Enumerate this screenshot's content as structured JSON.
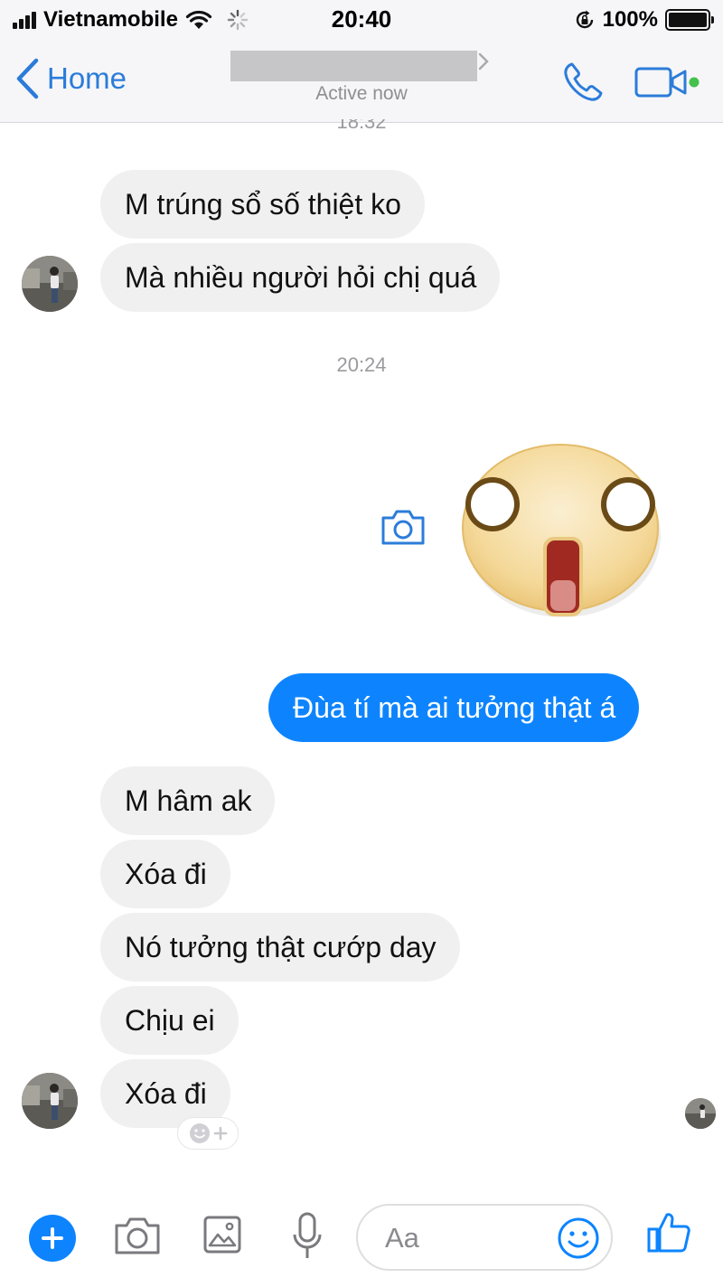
{
  "status_bar": {
    "carrier": "Vietnamobile",
    "time": "20:40",
    "battery": "100%"
  },
  "nav": {
    "back_label": "Home",
    "active_status": "Active now"
  },
  "messages": {
    "partial_timestamp": "18:32",
    "incoming_1": "M trúng sổ số thiệt ko",
    "incoming_2": "Mà nhiều người hỏi chị quá",
    "timestamp_2": "20:24",
    "outgoing_1": "Đùa tí mà ai tưởng thật á",
    "incoming_3": "M hâm ak",
    "incoming_4": "Xóa đi",
    "incoming_5": "Nó tưởng thật cướp day",
    "incoming_6": "Chịu ei",
    "incoming_7": "Xóa đi"
  },
  "composer": {
    "placeholder": "Aa"
  },
  "colors": {
    "accent": "#0d84fe",
    "nav_blue": "#2b7cd9",
    "incoming_bubble": "#f1f0f0",
    "online_dot": "#44c14b"
  }
}
